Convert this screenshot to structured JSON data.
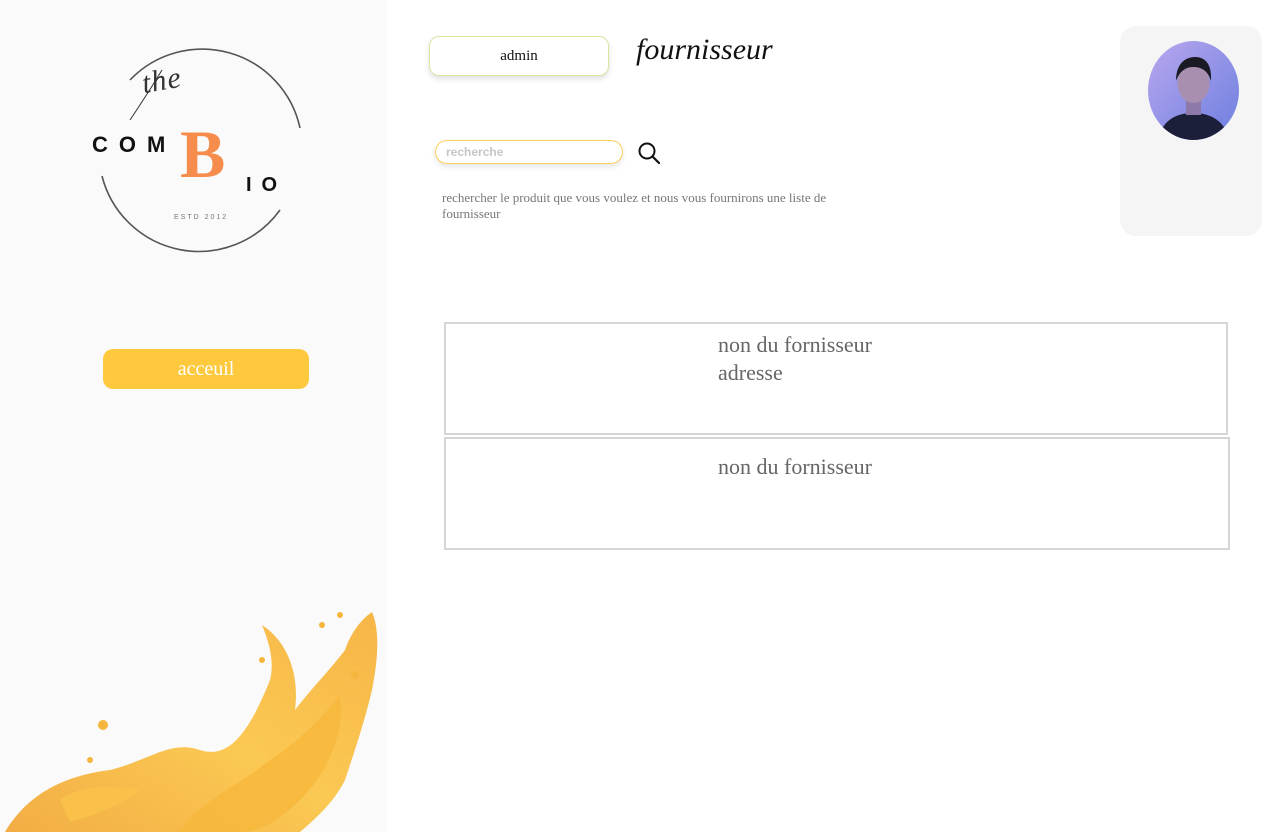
{
  "brand": {
    "logo_the": "the",
    "logo_com": "COM",
    "logo_b": "B",
    "logo_io": "IO",
    "logo_estd": "ESTD 2012",
    "accent_color": "#f78d4c"
  },
  "sidebar": {
    "nav_home_label": "acceuil",
    "nav_color": "#ffc93e"
  },
  "header": {
    "role_label": "admin",
    "page_title": "fournisseur"
  },
  "search": {
    "placeholder": "recherche",
    "value": "",
    "icon": "search-icon",
    "hint": "rechercher le produit que vous voulez et nous vous fournirons une liste de fournisseur"
  },
  "profile": {
    "avatar_icon": "user-avatar"
  },
  "suppliers": [
    {
      "name": "non du fornisseur",
      "address": "adresse"
    },
    {
      "name": "non du fornisseur"
    }
  ]
}
